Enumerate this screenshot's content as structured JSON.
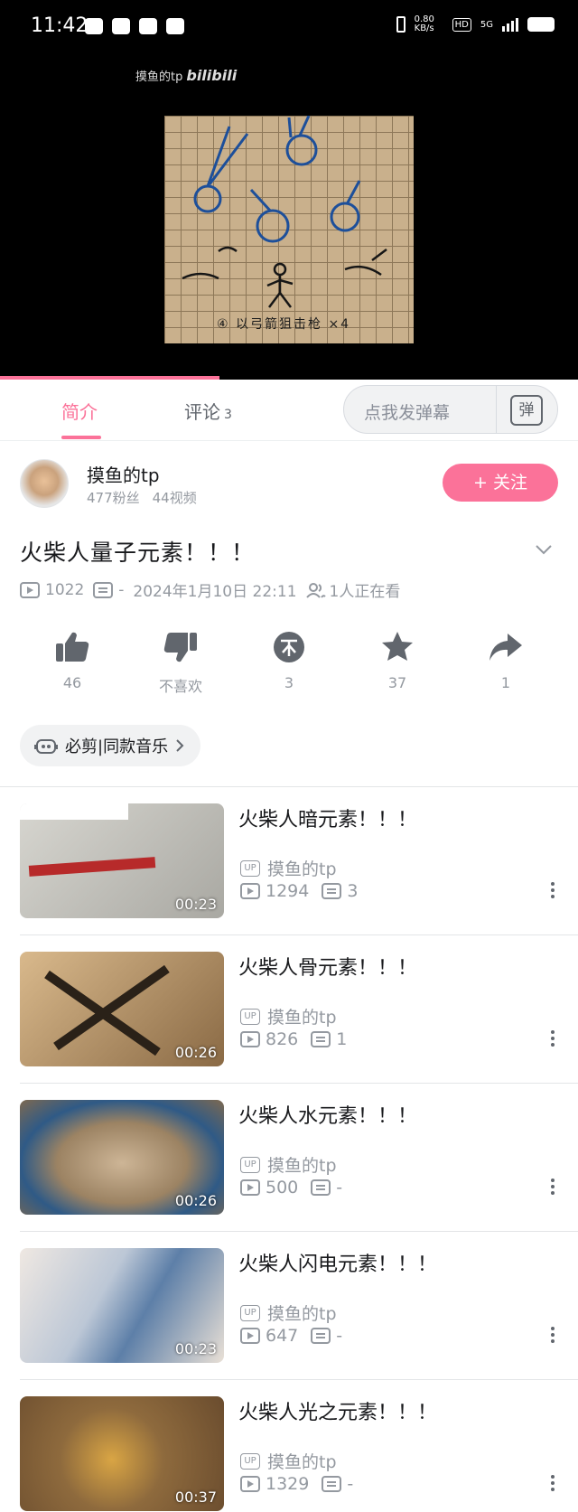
{
  "status_bar": {
    "time": "11:42",
    "net_speed": "0.80 KB/s",
    "hd": "HD",
    "net": "5G"
  },
  "player": {
    "watermark_user": "摸鱼的tp",
    "watermark_brand": "bilibili",
    "frame_caption": "④ 以弓箭狙击枪 ×4",
    "progress_fraction": 0.38
  },
  "tabs": [
    {
      "label": "简介",
      "active": true
    },
    {
      "label": "评论",
      "count": "3",
      "active": false
    }
  ],
  "danmaku": {
    "placeholder": "点我发弹幕",
    "button": "弹"
  },
  "uploader": {
    "name": "摸鱼的tp",
    "fans": "477粉丝",
    "videos": "44视频",
    "follow_label": "+ 关注"
  },
  "video": {
    "title": "火柴人量子元素！！！",
    "views": "1022",
    "danmaku_count": "-",
    "date": "2024年1月10日 22:11",
    "watching": "1人正在看"
  },
  "actions": [
    {
      "icon": "like-icon",
      "label": "46"
    },
    {
      "icon": "dislike-icon",
      "label": "不喜欢"
    },
    {
      "icon": "coin-icon",
      "label": "3"
    },
    {
      "icon": "favorite-icon",
      "label": "37"
    },
    {
      "icon": "share-icon",
      "label": "1"
    }
  ],
  "music_chip": {
    "label": "必剪|同款音乐"
  },
  "related": [
    {
      "title": "火柴人暗元素！！！",
      "up": "摸鱼的tp",
      "views": "1294",
      "comments": "3",
      "duration": "00:23"
    },
    {
      "title": "火柴人骨元素！！！",
      "up": "摸鱼的tp",
      "views": "826",
      "comments": "1",
      "duration": "00:26"
    },
    {
      "title": "火柴人水元素！！！",
      "up": "摸鱼的tp",
      "views": "500",
      "comments": "-",
      "duration": "00:26"
    },
    {
      "title": "火柴人闪电元素！！！",
      "up": "摸鱼的tp",
      "views": "647",
      "comments": "-",
      "duration": "00:23"
    },
    {
      "title": "火柴人光之元素！！！",
      "up": "摸鱼的tp",
      "views": "1329",
      "comments": "-",
      "duration": "00:37"
    }
  ],
  "colors": {
    "accent": "#fb7299",
    "muted": "#9499a0",
    "text": "#18191c"
  }
}
